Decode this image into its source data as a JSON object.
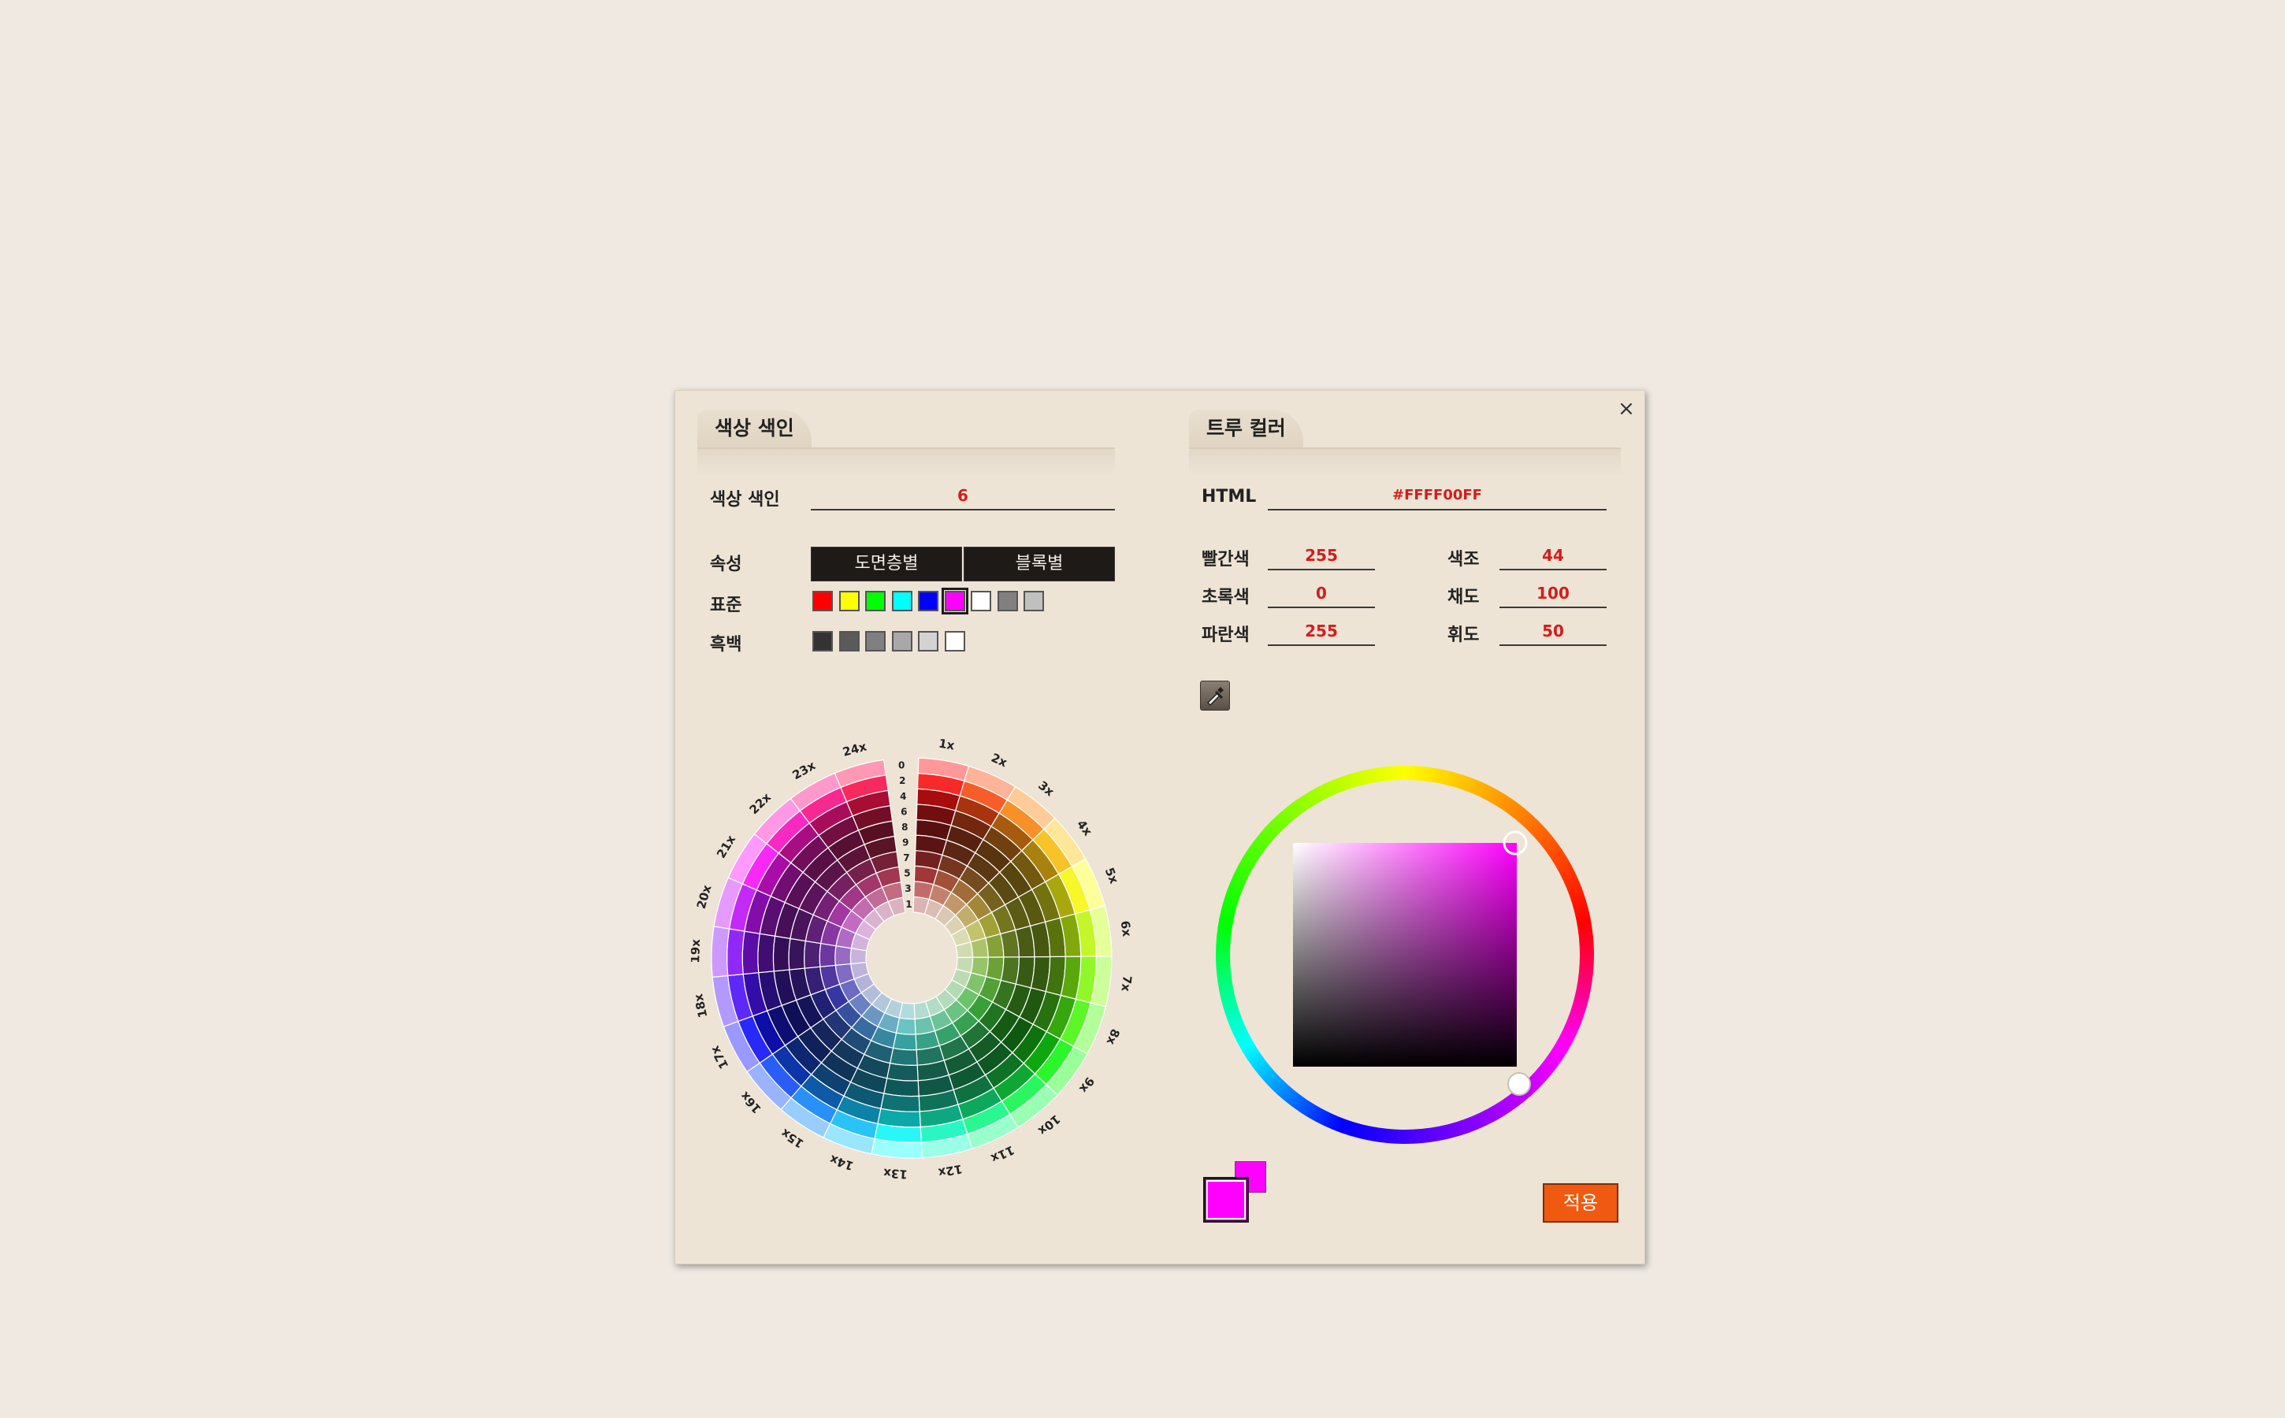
{
  "dialog": {
    "close_glyph": "×"
  },
  "left_panel": {
    "tab_title": "색상 색인",
    "color_index_label": "색상 색인",
    "color_index_value": "6",
    "property_label": "속성",
    "property_buttons": [
      "도면층별",
      "블록별"
    ],
    "standard_label": "표준",
    "standard_swatches": [
      "#ff0000",
      "#ffff00",
      "#00ff00",
      "#00ffff",
      "#0000ff",
      "#ff00ff",
      "#ffffff",
      "#808080",
      "#c0c0c0"
    ],
    "selected_standard_index": 5,
    "gray_label": "흑백",
    "gray_swatches": [
      "#333333",
      "#5a5a5a",
      "#808080",
      "#a8a8a8",
      "#d3d3d3",
      "#ffffff"
    ],
    "wheel": {
      "hue_labels": [
        "1x",
        "2x",
        "3x",
        "4x",
        "5x",
        "6x",
        "7x",
        "8x",
        "9x",
        "10x",
        "11x",
        "12x",
        "13x",
        "14x",
        "15x",
        "16x",
        "17x",
        "18x",
        "19x",
        "20x",
        "21x",
        "22x",
        "23x",
        "24x"
      ],
      "ring_labels": [
        "0",
        "2",
        "4",
        "6",
        "8",
        "9",
        "7",
        "5",
        "3",
        "1"
      ]
    }
  },
  "right_panel": {
    "tab_title": "트루 컬러",
    "html_label": "HTML",
    "html_value": "#FFFF00FF",
    "red_label": "빨간색",
    "red_value": "255",
    "green_label": "초록색",
    "green_value": "0",
    "blue_label": "파란색",
    "blue_value": "255",
    "hue_label": "색조",
    "hue_value": "44",
    "sat_label": "채도",
    "sat_value": "100",
    "lum_label": "휘도",
    "lum_value": "50",
    "eyedropper_icon": "eyedropper-icon",
    "preview_current": "#ff00ff",
    "preview_previous": "#ff00ff",
    "apply_label": "적용"
  }
}
